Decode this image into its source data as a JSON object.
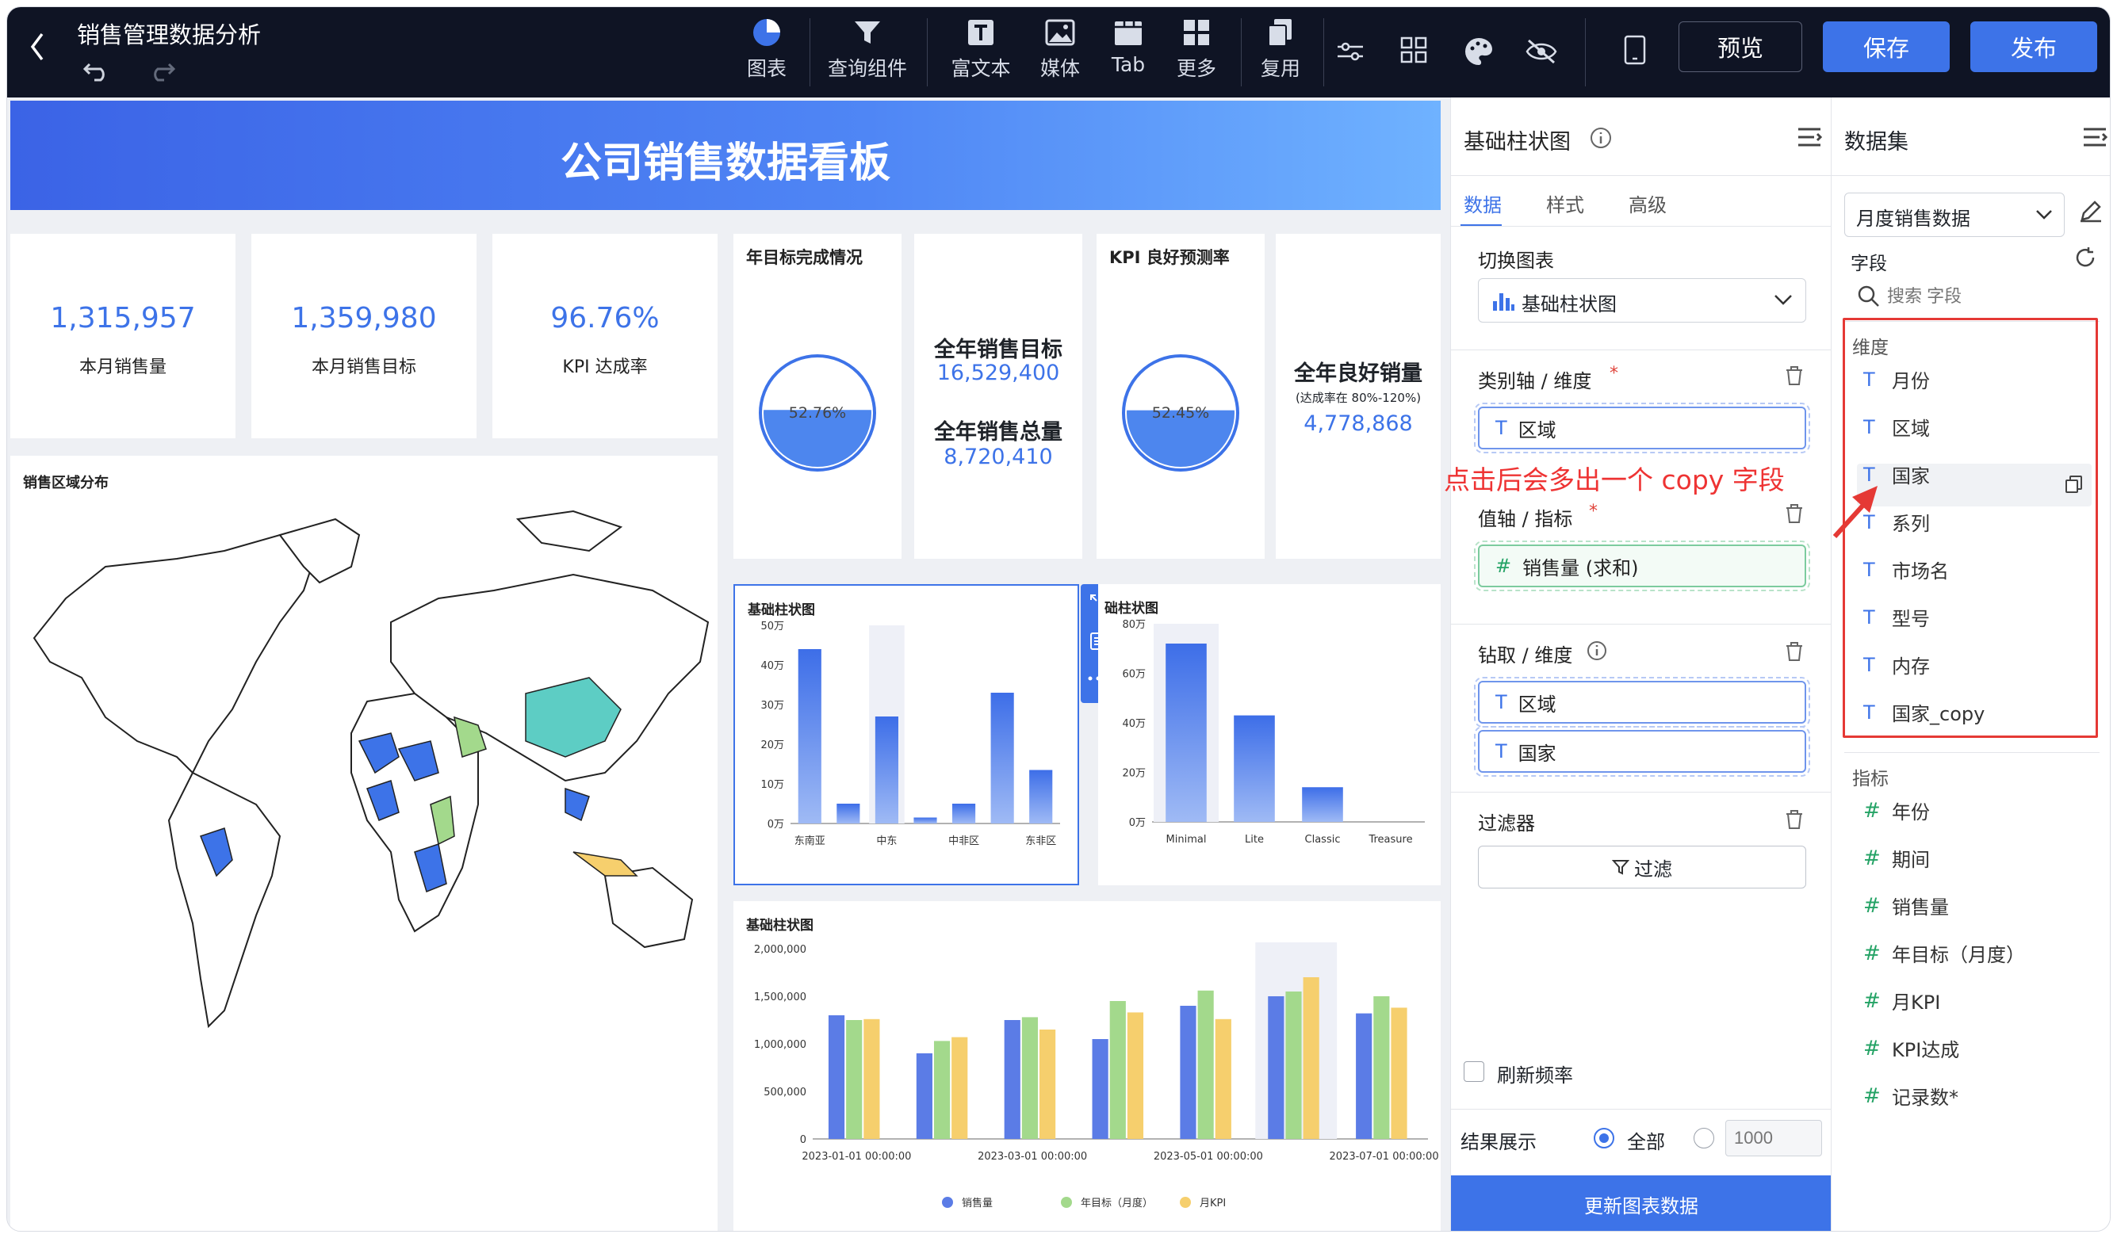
{
  "topbar": {
    "title": "销售管理数据分析",
    "tools": [
      {
        "icon": "chart-pie-icon",
        "label": "图表"
      },
      {
        "icon": "funnel-icon",
        "label": "查询组件"
      },
      {
        "icon": "rich-text-icon",
        "label": "富文本"
      },
      {
        "icon": "image-icon",
        "label": "媒体"
      },
      {
        "icon": "tab-icon",
        "label": "Tab"
      },
      {
        "icon": "grid-icon",
        "label": "更多"
      },
      {
        "icon": "copy-icon",
        "label": "复用"
      }
    ],
    "preview": "预览",
    "save": "保存",
    "publish": "发布"
  },
  "banner": {
    "title": "公司销售数据看板"
  },
  "kpis": [
    {
      "value": "1,315,957",
      "label": "本月销售量"
    },
    {
      "value": "1,359,980",
      "label": "本月销售目标"
    },
    {
      "value": "96.76%",
      "label": "KPI 达成率"
    }
  ],
  "goal_card": {
    "title": "年目标完成情况",
    "percent": "52.76%",
    "fill": 0.5276
  },
  "goal_text": {
    "l1": "全年销售目标",
    "v1": "16,529,400",
    "l2": "全年销售总量",
    "v2": "8,720,410"
  },
  "kpi_card": {
    "title": "KPI 良好预测率",
    "percent": "52.45%",
    "fill": 0.5245
  },
  "good_text": {
    "l1": "全年良好销量",
    "note": "(达成率在 80%-120%)",
    "v1": "4,778,868"
  },
  "map": {
    "title": "销售区域分布"
  },
  "chart_data": [
    {
      "type": "bar",
      "title": "基础柱状图",
      "categories": [
        "东南亚",
        "中东",
        "中非区",
        "东非区"
      ],
      "x_tick_positions": [
        "东南亚",
        "",
        "中东",
        "",
        "中非区",
        "",
        "东非区"
      ],
      "values": [
        44,
        5,
        27,
        1.5,
        5,
        33,
        13.5
      ],
      "ylabels": [
        "50万",
        "40万",
        "30万",
        "20万",
        "10万",
        "0万"
      ],
      "ylim": [
        0,
        50
      ]
    },
    {
      "type": "bar",
      "title": "础柱状图",
      "categories": [
        "Minimal",
        "Lite",
        "Classic",
        "Treasure"
      ],
      "values": [
        72,
        43,
        14,
        0
      ],
      "ylabels": [
        "80万",
        "60万",
        "40万",
        "20万",
        "0万"
      ],
      "ylim": [
        0,
        80
      ]
    },
    {
      "type": "bar",
      "title": "基础柱状图",
      "x": [
        "2023-01-01 00:00:00",
        "2023-03-01 00:00:00",
        "2023-05-01 00:00:00",
        "2023-07-01 00:00:00"
      ],
      "ylabels": [
        "2,000,000",
        "1,500,000",
        "1,000,000",
        "500,000",
        "0"
      ],
      "ylim": [
        0,
        2000000
      ],
      "series": [
        {
          "name": "销售量",
          "color": "#5b7ce6",
          "values": [
            1300000,
            900000,
            1250000,
            1050000,
            1400000,
            1500000,
            1320000
          ]
        },
        {
          "name": "年目标（月度）",
          "color": "#a3d98c",
          "values": [
            1250000,
            1030000,
            1280000,
            1450000,
            1560000,
            1550000,
            1500000
          ]
        },
        {
          "name": "月KPI",
          "color": "#f6cf6d",
          "values": [
            1260000,
            1070000,
            1150000,
            1330000,
            1260000,
            1700000,
            1380000
          ]
        }
      ]
    }
  ],
  "config": {
    "title": "基础柱状图",
    "tabs": [
      "数据",
      "样式",
      "高级"
    ],
    "switch_label": "切换图表",
    "chart_type": "基础柱状图",
    "axis_label": "类别轴 / 维度",
    "axis_field": "区域",
    "value_label": "值轴 / 指标",
    "value_field": "销售量 (求和)",
    "drill_label": "钻取 / 维度",
    "drill_fields": [
      "区域",
      "国家"
    ],
    "filter_label": "过滤器",
    "filter_btn": "过滤",
    "refresh_label": "刷新频率",
    "result_label": "结果展示",
    "result_all": "全部",
    "result_limit_placeholder": "1000",
    "update_btn": "更新图表数据",
    "annotation": "点击后会多出一个 copy 字段"
  },
  "dataset": {
    "title": "数据集",
    "selected": "月度销售数据",
    "fields_label": "字段",
    "search_placeholder": "搜索 字段",
    "dim_label": "维度",
    "dims": [
      "月份",
      "区域",
      "国家",
      "系列",
      "市场名",
      "型号",
      "内存",
      "国家_copy"
    ],
    "measure_label": "指标",
    "measures": [
      "年份",
      "期间",
      "销售量",
      "年目标（月度）",
      "月KPI",
      "KPI达成",
      "记录数*"
    ]
  }
}
